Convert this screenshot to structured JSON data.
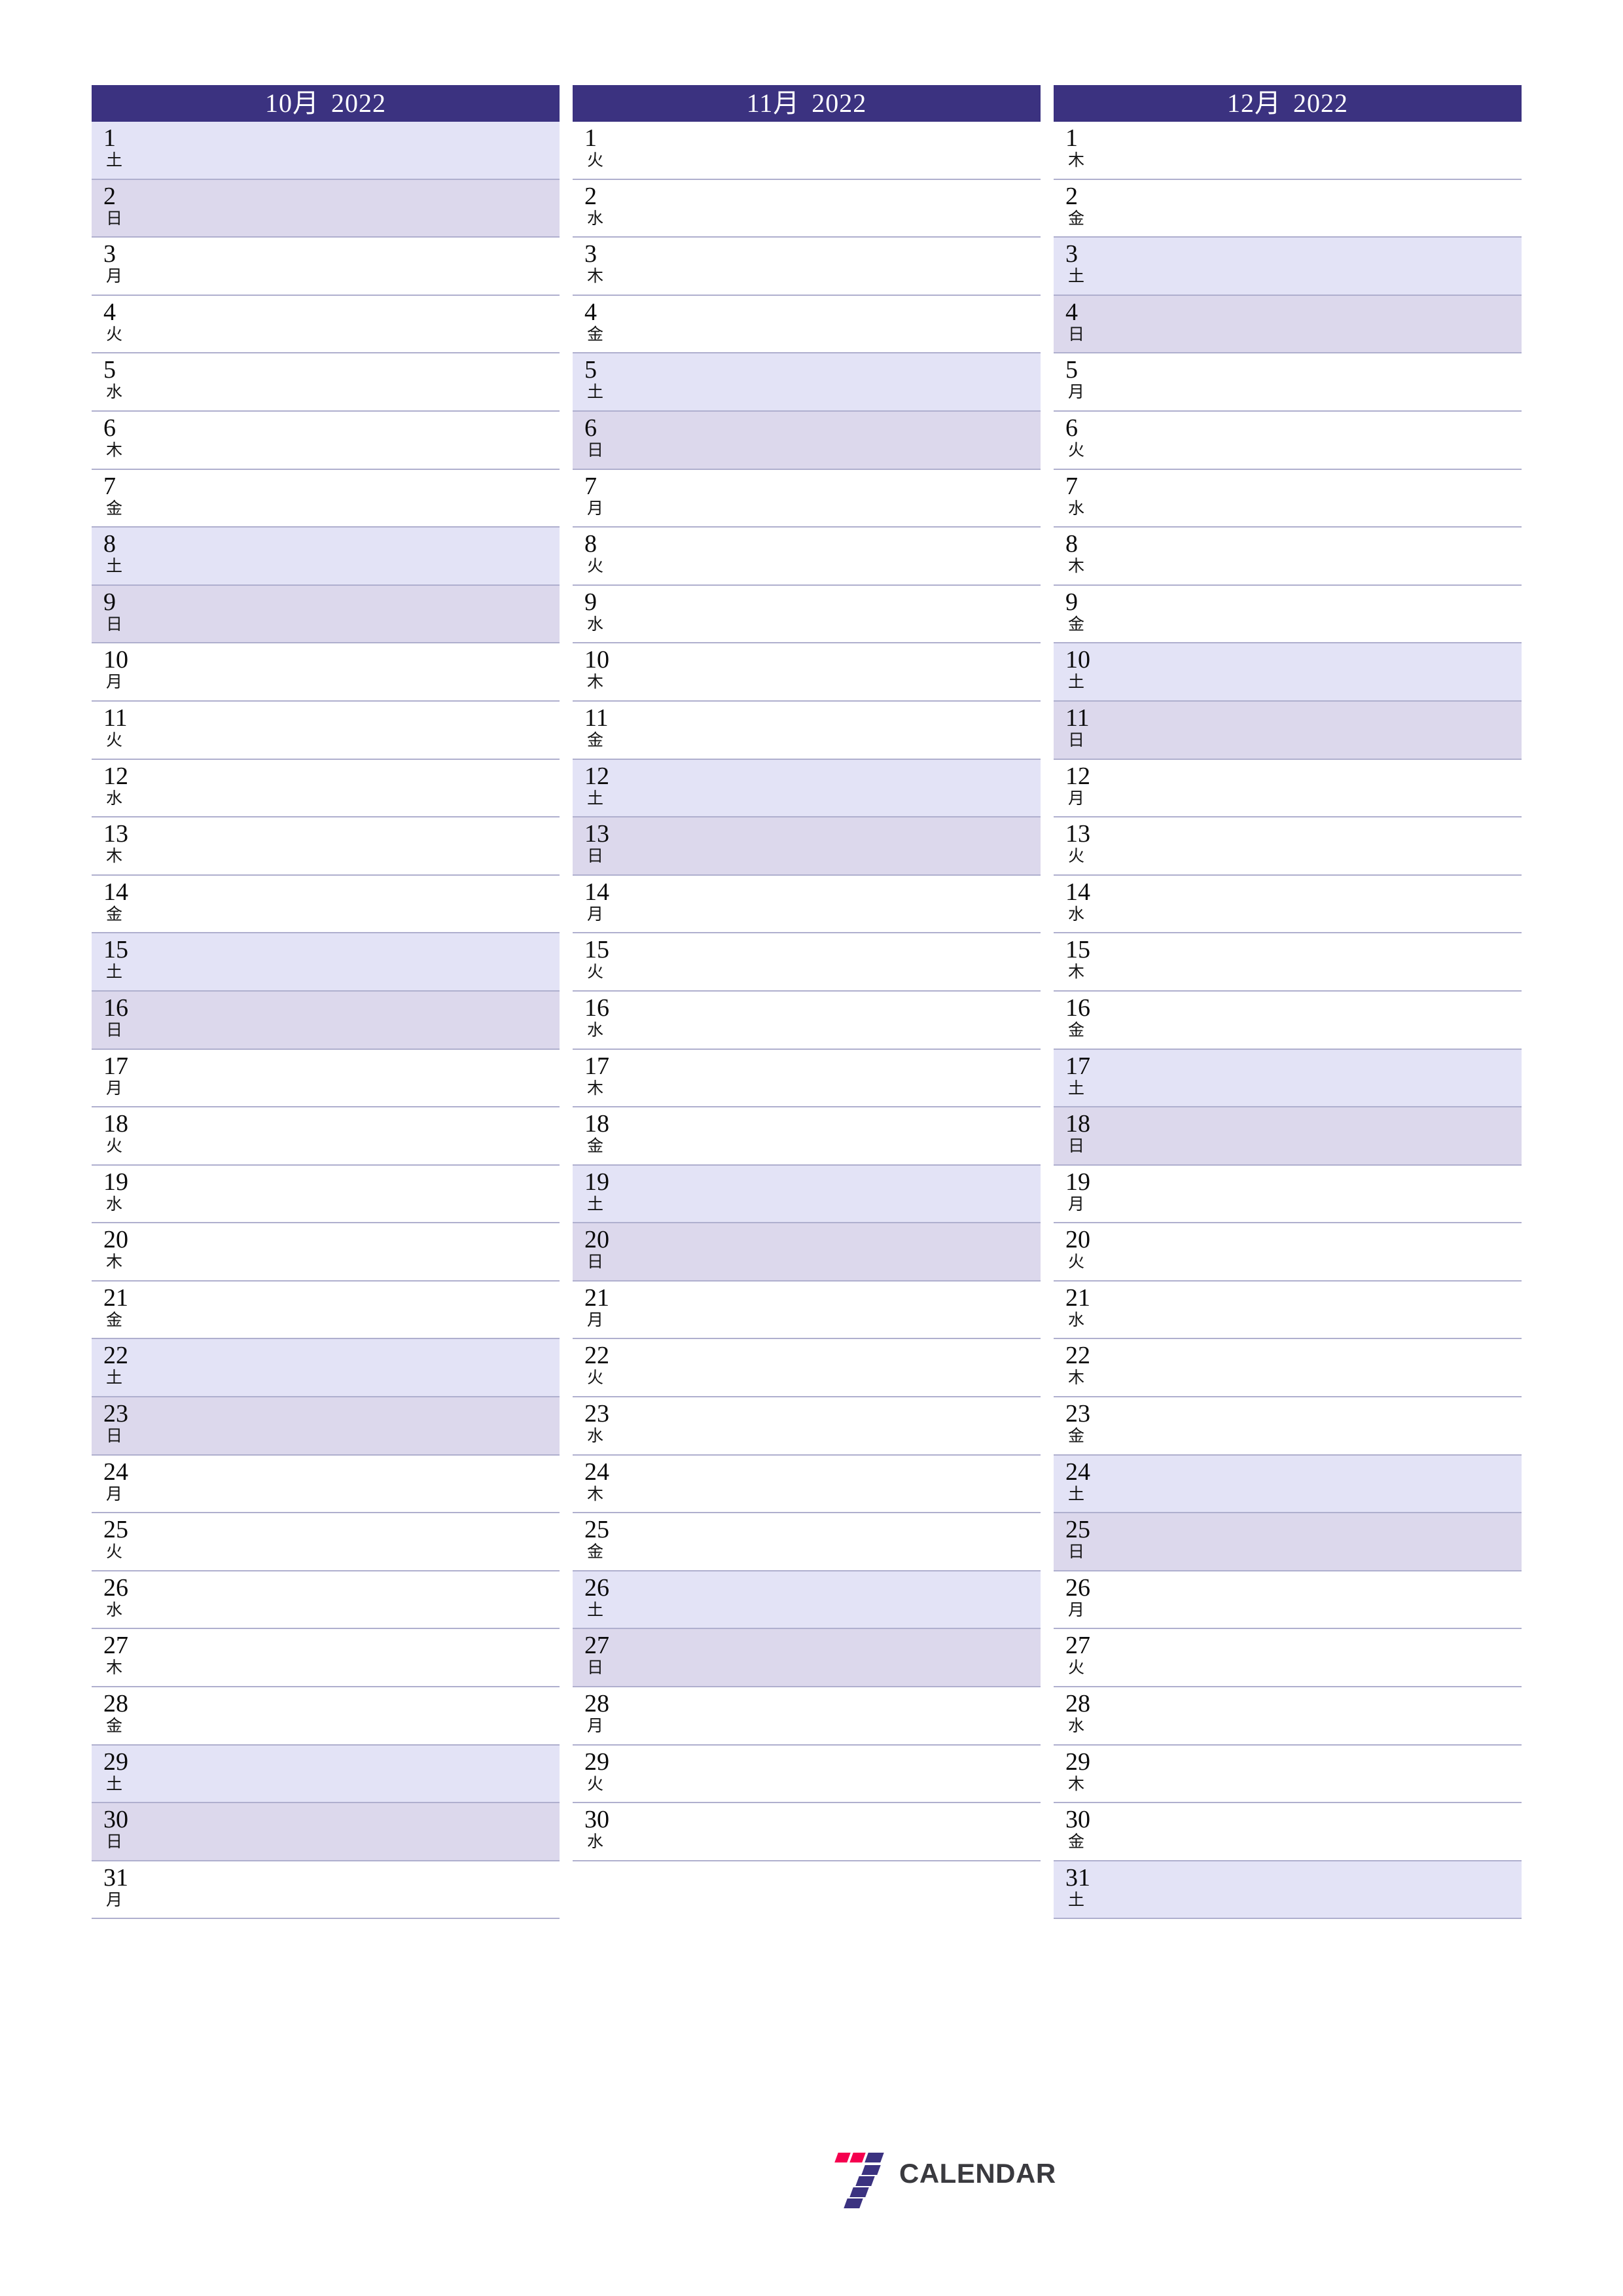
{
  "colors": {
    "header_bg": "#3B3280",
    "header_text": "#FFFFFF",
    "saturday_bg": "#E3E3F6",
    "sunday_bg": "#DCD8EC",
    "weekday_bg": "#FFFFFF",
    "row_border": "#AFAFCE",
    "logo_indigo": "#3B3280",
    "logo_red": "#F5004F",
    "logo_text": "#3A3A3F"
  },
  "brand": {
    "mark_name": "seven-logo-icon",
    "wordmark": "CALENDAR"
  },
  "weekday_glyphs": {
    "mon": "月",
    "tue": "火",
    "wed": "水",
    "thu": "木",
    "fri": "金",
    "sat": "土",
    "sun": "日"
  },
  "months": [
    {
      "id": "october-2022",
      "month_label": "10月",
      "year_label": "2022",
      "days": [
        {
          "num": "1",
          "wd": "土",
          "type": "sat"
        },
        {
          "num": "2",
          "wd": "日",
          "type": "sun"
        },
        {
          "num": "3",
          "wd": "月",
          "type": "wd"
        },
        {
          "num": "4",
          "wd": "火",
          "type": "wd"
        },
        {
          "num": "5",
          "wd": "水",
          "type": "wd"
        },
        {
          "num": "6",
          "wd": "木",
          "type": "wd"
        },
        {
          "num": "7",
          "wd": "金",
          "type": "wd"
        },
        {
          "num": "8",
          "wd": "土",
          "type": "sat"
        },
        {
          "num": "9",
          "wd": "日",
          "type": "sun"
        },
        {
          "num": "10",
          "wd": "月",
          "type": "wd"
        },
        {
          "num": "11",
          "wd": "火",
          "type": "wd"
        },
        {
          "num": "12",
          "wd": "水",
          "type": "wd"
        },
        {
          "num": "13",
          "wd": "木",
          "type": "wd"
        },
        {
          "num": "14",
          "wd": "金",
          "type": "wd"
        },
        {
          "num": "15",
          "wd": "土",
          "type": "sat"
        },
        {
          "num": "16",
          "wd": "日",
          "type": "sun"
        },
        {
          "num": "17",
          "wd": "月",
          "type": "wd"
        },
        {
          "num": "18",
          "wd": "火",
          "type": "wd"
        },
        {
          "num": "19",
          "wd": "水",
          "type": "wd"
        },
        {
          "num": "20",
          "wd": "木",
          "type": "wd"
        },
        {
          "num": "21",
          "wd": "金",
          "type": "wd"
        },
        {
          "num": "22",
          "wd": "土",
          "type": "sat"
        },
        {
          "num": "23",
          "wd": "日",
          "type": "sun"
        },
        {
          "num": "24",
          "wd": "月",
          "type": "wd"
        },
        {
          "num": "25",
          "wd": "火",
          "type": "wd"
        },
        {
          "num": "26",
          "wd": "水",
          "type": "wd"
        },
        {
          "num": "27",
          "wd": "木",
          "type": "wd"
        },
        {
          "num": "28",
          "wd": "金",
          "type": "wd"
        },
        {
          "num": "29",
          "wd": "土",
          "type": "sat"
        },
        {
          "num": "30",
          "wd": "日",
          "type": "sun"
        },
        {
          "num": "31",
          "wd": "月",
          "type": "wd"
        }
      ]
    },
    {
      "id": "november-2022",
      "month_label": "11月",
      "year_label": "2022",
      "days": [
        {
          "num": "1",
          "wd": "火",
          "type": "wd"
        },
        {
          "num": "2",
          "wd": "水",
          "type": "wd"
        },
        {
          "num": "3",
          "wd": "木",
          "type": "wd"
        },
        {
          "num": "4",
          "wd": "金",
          "type": "wd"
        },
        {
          "num": "5",
          "wd": "土",
          "type": "sat"
        },
        {
          "num": "6",
          "wd": "日",
          "type": "sun"
        },
        {
          "num": "7",
          "wd": "月",
          "type": "wd"
        },
        {
          "num": "8",
          "wd": "火",
          "type": "wd"
        },
        {
          "num": "9",
          "wd": "水",
          "type": "wd"
        },
        {
          "num": "10",
          "wd": "木",
          "type": "wd"
        },
        {
          "num": "11",
          "wd": "金",
          "type": "wd"
        },
        {
          "num": "12",
          "wd": "土",
          "type": "sat"
        },
        {
          "num": "13",
          "wd": "日",
          "type": "sun"
        },
        {
          "num": "14",
          "wd": "月",
          "type": "wd"
        },
        {
          "num": "15",
          "wd": "火",
          "type": "wd"
        },
        {
          "num": "16",
          "wd": "水",
          "type": "wd"
        },
        {
          "num": "17",
          "wd": "木",
          "type": "wd"
        },
        {
          "num": "18",
          "wd": "金",
          "type": "wd"
        },
        {
          "num": "19",
          "wd": "土",
          "type": "sat"
        },
        {
          "num": "20",
          "wd": "日",
          "type": "sun"
        },
        {
          "num": "21",
          "wd": "月",
          "type": "wd"
        },
        {
          "num": "22",
          "wd": "火",
          "type": "wd"
        },
        {
          "num": "23",
          "wd": "水",
          "type": "wd"
        },
        {
          "num": "24",
          "wd": "木",
          "type": "wd"
        },
        {
          "num": "25",
          "wd": "金",
          "type": "wd"
        },
        {
          "num": "26",
          "wd": "土",
          "type": "sat"
        },
        {
          "num": "27",
          "wd": "日",
          "type": "sun"
        },
        {
          "num": "28",
          "wd": "月",
          "type": "wd"
        },
        {
          "num": "29",
          "wd": "火",
          "type": "wd"
        },
        {
          "num": "30",
          "wd": "水",
          "type": "wd"
        }
      ]
    },
    {
      "id": "december-2022",
      "month_label": "12月",
      "year_label": "2022",
      "days": [
        {
          "num": "1",
          "wd": "木",
          "type": "wd"
        },
        {
          "num": "2",
          "wd": "金",
          "type": "wd"
        },
        {
          "num": "3",
          "wd": "土",
          "type": "sat"
        },
        {
          "num": "4",
          "wd": "日",
          "type": "sun"
        },
        {
          "num": "5",
          "wd": "月",
          "type": "wd"
        },
        {
          "num": "6",
          "wd": "火",
          "type": "wd"
        },
        {
          "num": "7",
          "wd": "水",
          "type": "wd"
        },
        {
          "num": "8",
          "wd": "木",
          "type": "wd"
        },
        {
          "num": "9",
          "wd": "金",
          "type": "wd"
        },
        {
          "num": "10",
          "wd": "土",
          "type": "sat"
        },
        {
          "num": "11",
          "wd": "日",
          "type": "sun"
        },
        {
          "num": "12",
          "wd": "月",
          "type": "wd"
        },
        {
          "num": "13",
          "wd": "火",
          "type": "wd"
        },
        {
          "num": "14",
          "wd": "水",
          "type": "wd"
        },
        {
          "num": "15",
          "wd": "木",
          "type": "wd"
        },
        {
          "num": "16",
          "wd": "金",
          "type": "wd"
        },
        {
          "num": "17",
          "wd": "土",
          "type": "sat"
        },
        {
          "num": "18",
          "wd": "日",
          "type": "sun"
        },
        {
          "num": "19",
          "wd": "月",
          "type": "wd"
        },
        {
          "num": "20",
          "wd": "火",
          "type": "wd"
        },
        {
          "num": "21",
          "wd": "水",
          "type": "wd"
        },
        {
          "num": "22",
          "wd": "木",
          "type": "wd"
        },
        {
          "num": "23",
          "wd": "金",
          "type": "wd"
        },
        {
          "num": "24",
          "wd": "土",
          "type": "sat"
        },
        {
          "num": "25",
          "wd": "日",
          "type": "sun"
        },
        {
          "num": "26",
          "wd": "月",
          "type": "wd"
        },
        {
          "num": "27",
          "wd": "火",
          "type": "wd"
        },
        {
          "num": "28",
          "wd": "水",
          "type": "wd"
        },
        {
          "num": "29",
          "wd": "木",
          "type": "wd"
        },
        {
          "num": "30",
          "wd": "金",
          "type": "wd"
        },
        {
          "num": "31",
          "wd": "土",
          "type": "sat"
        }
      ]
    }
  ]
}
